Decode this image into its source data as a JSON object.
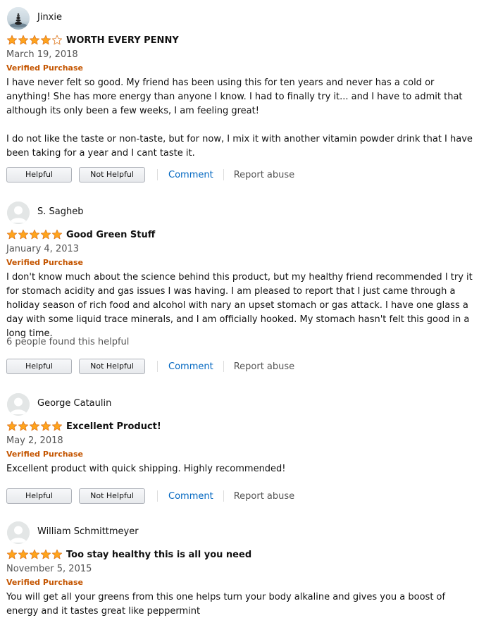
{
  "colors": {
    "star": "#ffa41c",
    "verified": "#c45500",
    "link": "#0066c0"
  },
  "reviews": [
    {
      "author": "Jinxie",
      "avatar_icon": "custom-avatar-icon",
      "rating": 4,
      "title": "WORTH EVERY PENNY",
      "date": "March 19, 2018",
      "verified": "Verified Purchase",
      "body": [
        "I have never felt so good. My friend has been using this for ten years and never has a cold or anything! She has more energy than anyone I know. I had to finally try it... and I have to admit that although its only been a few weeks, I am feeling great!",
        "I do not like the taste or non-taste, but for now, I mix it with another vitamin powder drink that I have been taking for a year and I cant taste it."
      ],
      "helpful_count": "",
      "helpful_label": "Helpful",
      "not_helpful_label": "Not Helpful",
      "comment_label": "Comment",
      "report_label": "Report abuse"
    },
    {
      "author": "S. Sagheb",
      "avatar_icon": "default-avatar-icon",
      "rating": 5,
      "title": "Good Green Stuff",
      "date": "January 4, 2013",
      "verified": "Verified Purchase",
      "body": [
        "I don't know much about the science behind this product, but my healthy friend recommended I try it for stomach acidity and gas issues I was having. I am pleased to report that I just came through a holiday season of rich food and alcohol with nary an upset stomach or gas attack. I have one glass a day with some liquid trace minerals, and I am officially hooked. My stomach hasn't felt this good in a long time."
      ],
      "helpful_count": "6 people found this helpful",
      "helpful_label": "Helpful",
      "not_helpful_label": "Not Helpful",
      "comment_label": "Comment",
      "report_label": "Report abuse"
    },
    {
      "author": "George Cataulin",
      "avatar_icon": "default-avatar-icon",
      "rating": 5,
      "title": "Excellent Product!",
      "date": "May 2, 2018",
      "verified": "Verified Purchase",
      "body": [
        "Excellent product with quick shipping. Highly recommended!"
      ],
      "helpful_count": "",
      "helpful_label": "Helpful",
      "not_helpful_label": "Not Helpful",
      "comment_label": "Comment",
      "report_label": "Report abuse"
    },
    {
      "author": "William Schmittmeyer",
      "avatar_icon": "default-avatar-icon",
      "rating": 5,
      "title": "Too stay healthy this is all you need",
      "date": "November 5, 2015",
      "verified": "Verified Purchase",
      "body": [
        "You will get all your greens from this one helps turn your body alkaline and gives you a boost of energy and it tastes great like peppermint"
      ],
      "helpful_count": "",
      "helpful_label": "",
      "not_helpful_label": "",
      "comment_label": "",
      "report_label": ""
    }
  ]
}
